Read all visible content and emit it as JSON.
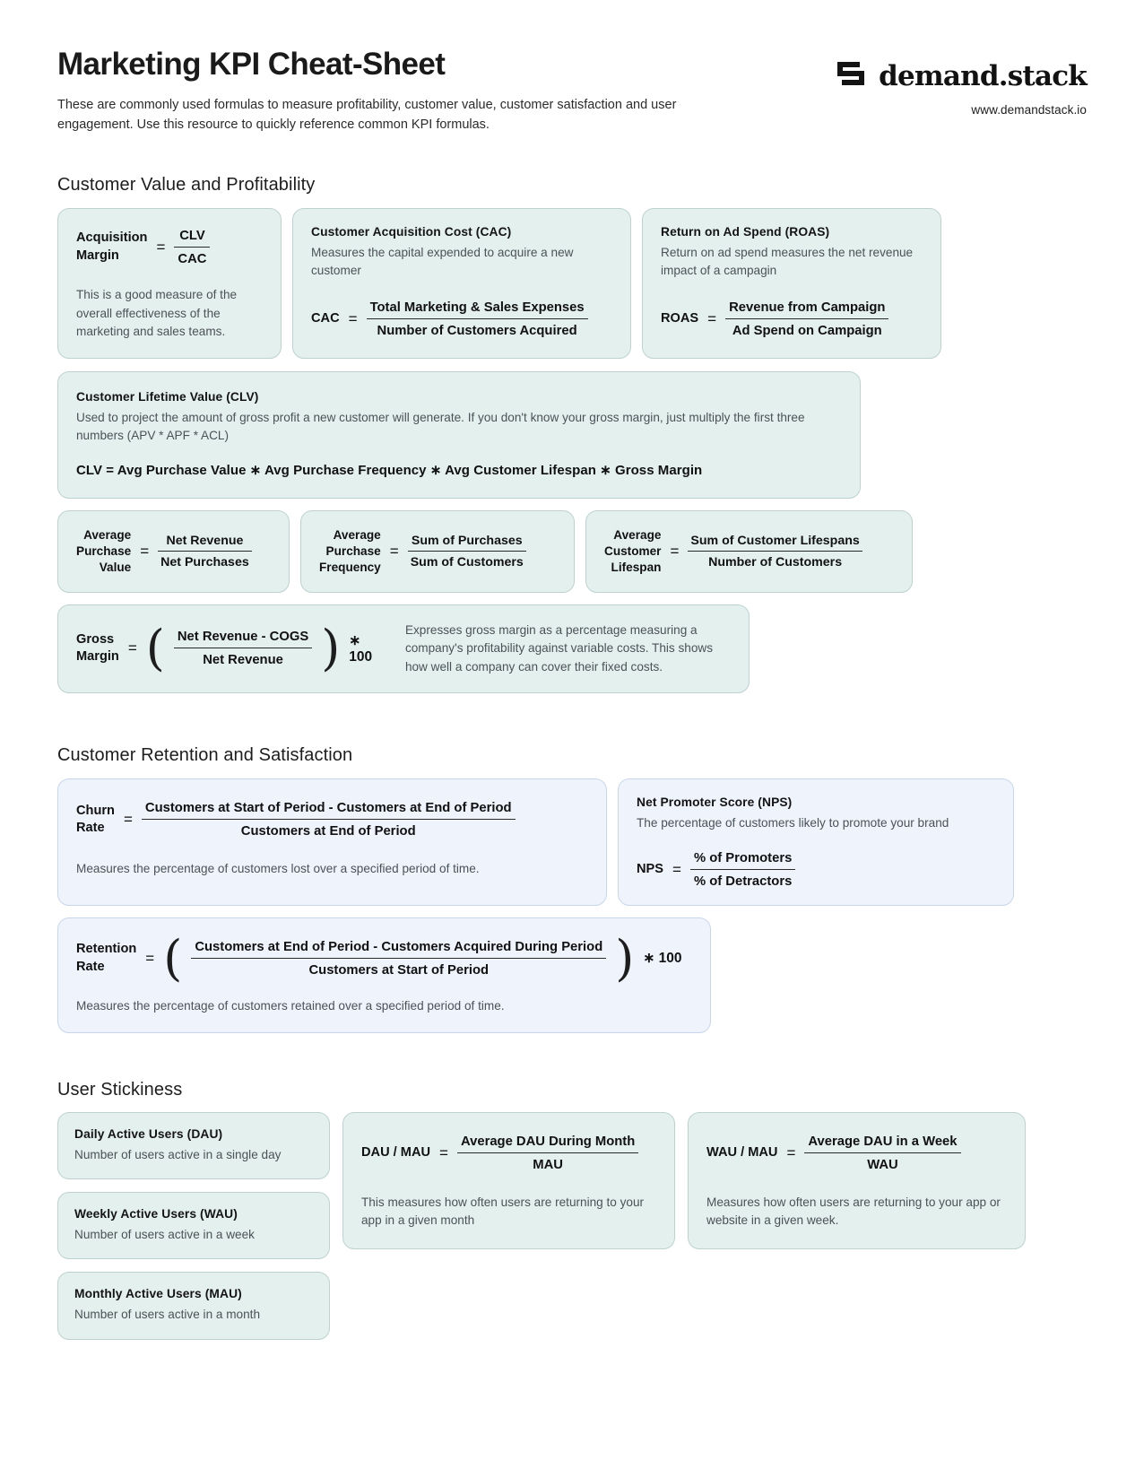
{
  "header": {
    "title": "Marketing KPI Cheat-Sheet",
    "subtitle": "These are commonly used formulas to measure profitability, customer value, customer satisfaction and user engagement. Use this resource to quickly reference common KPI formulas.",
    "brand_name": "demand.stack",
    "brand_url": "www.demandstack.io",
    "logo_icon": "demandstack-s-block-logo"
  },
  "colors": {
    "teal_card_bg": "#e4f0ee",
    "teal_card_border": "#bdd2cf",
    "blue_card_bg": "#eef3fc",
    "blue_card_border": "#c8d6ec",
    "page_bg": "#ffffff",
    "text": "#1d1d1d",
    "muted_text": "#4b5257"
  },
  "sections": [
    {
      "id": "customer-value",
      "title": "Customer Value and Profitability"
    },
    {
      "id": "customer-retention",
      "title": "Customer Retention and Satisfaction"
    },
    {
      "id": "user-stickiness",
      "title": "User Stickiness"
    }
  ],
  "acquisition_margin": {
    "lhs": "Acquisition\nMargin",
    "equals": "=",
    "numerator": "CLV",
    "denominator": "CAC",
    "note": "This is a good measure of the overall effectiveness of the marketing and sales teams."
  },
  "cac": {
    "title": "Customer Acquisition Cost (CAC)",
    "desc": "Measures the capital expended to acquire a new customer",
    "lhs": "CAC",
    "equals": "=",
    "numerator": "Total Marketing & Sales Expenses",
    "denominator": "Number of Customers Acquired"
  },
  "roas": {
    "title": "Return on Ad Spend (ROAS)",
    "desc": "Return on ad spend measures the net revenue impact of a campagin",
    "lhs": "ROAS",
    "equals": "=",
    "numerator": "Revenue from Campaign",
    "denominator": "Ad Spend on Campaign"
  },
  "clv": {
    "title": "Customer Lifetime Value (CLV)",
    "desc": "Used to project the amount of gross profit a new customer will generate. If you don't know your gross margin, just multiply the first three numbers (APV * APF * ACL)",
    "formula": "CLV =  Avg Purchase Value  ∗  Avg Purchase Frequency  ∗  Avg Customer Lifespan  ∗  Gross Margin"
  },
  "averages": [
    {
      "lhs": "Average\nPurchase\nValue",
      "equals": "=",
      "numerator": "Net Revenue",
      "denominator": "Net Purchases"
    },
    {
      "lhs": "Average\nPurchase\nFrequency",
      "equals": "=",
      "numerator": "Sum of Purchases",
      "denominator": "Sum of Customers"
    },
    {
      "lhs": "Average\nCustomer\nLifespan",
      "equals": "=",
      "numerator": "Sum of Customer Lifespans",
      "denominator": "Number of Customers"
    }
  ],
  "gross_margin": {
    "lhs": "Gross\nMargin",
    "equals": "=",
    "numerator": "Net Revenue - COGS",
    "denominator": "Net Revenue",
    "multiplier": "∗ 100",
    "note": "Expresses gross margin as a percentage measuring a company's profitability against variable costs. This shows how well a company can cover their fixed costs."
  },
  "churn": {
    "lhs": "Churn\nRate",
    "equals": "=",
    "numerator": "Customers at Start of Period - Customers at End of Period",
    "denominator": "Customers at End of Period",
    "note": "Measures the percentage of customers lost over a specified period of time."
  },
  "nps": {
    "title": "Net Promoter Score (NPS)",
    "desc": "The percentage of customers likely to promote your brand",
    "lhs": "NPS",
    "equals": "=",
    "numerator": "% of Promoters",
    "denominator": "% of Detractors"
  },
  "retention": {
    "lhs": "Retention\nRate",
    "equals": "=",
    "numerator": "Customers at End of Period - Customers Acquired During Period",
    "denominator": "Customers at Start of Period",
    "multiplier": "∗ 100",
    "note": "Measures the percentage of customers retained over a specified period of time."
  },
  "active_users": [
    {
      "title": "Daily Active Users (DAU)",
      "desc": "Number of users active in a single day"
    },
    {
      "title": "Weekly Active Users (WAU)",
      "desc": "Number of users active in a week"
    },
    {
      "title": "Monthly Active Users (MAU)",
      "desc": "Number of users active in a month"
    }
  ],
  "dau_mau": {
    "lhs": "DAU / MAU",
    "equals": "=",
    "numerator": "Average DAU During Month",
    "denominator": "MAU",
    "note": "This measures how often users are returning to your app in a given month"
  },
  "wau_mau": {
    "lhs": "WAU / MAU",
    "equals": "=",
    "numerator": "Average DAU in a Week",
    "denominator": "WAU",
    "note": "Measures how often users are returning to your app or website in a given week."
  }
}
